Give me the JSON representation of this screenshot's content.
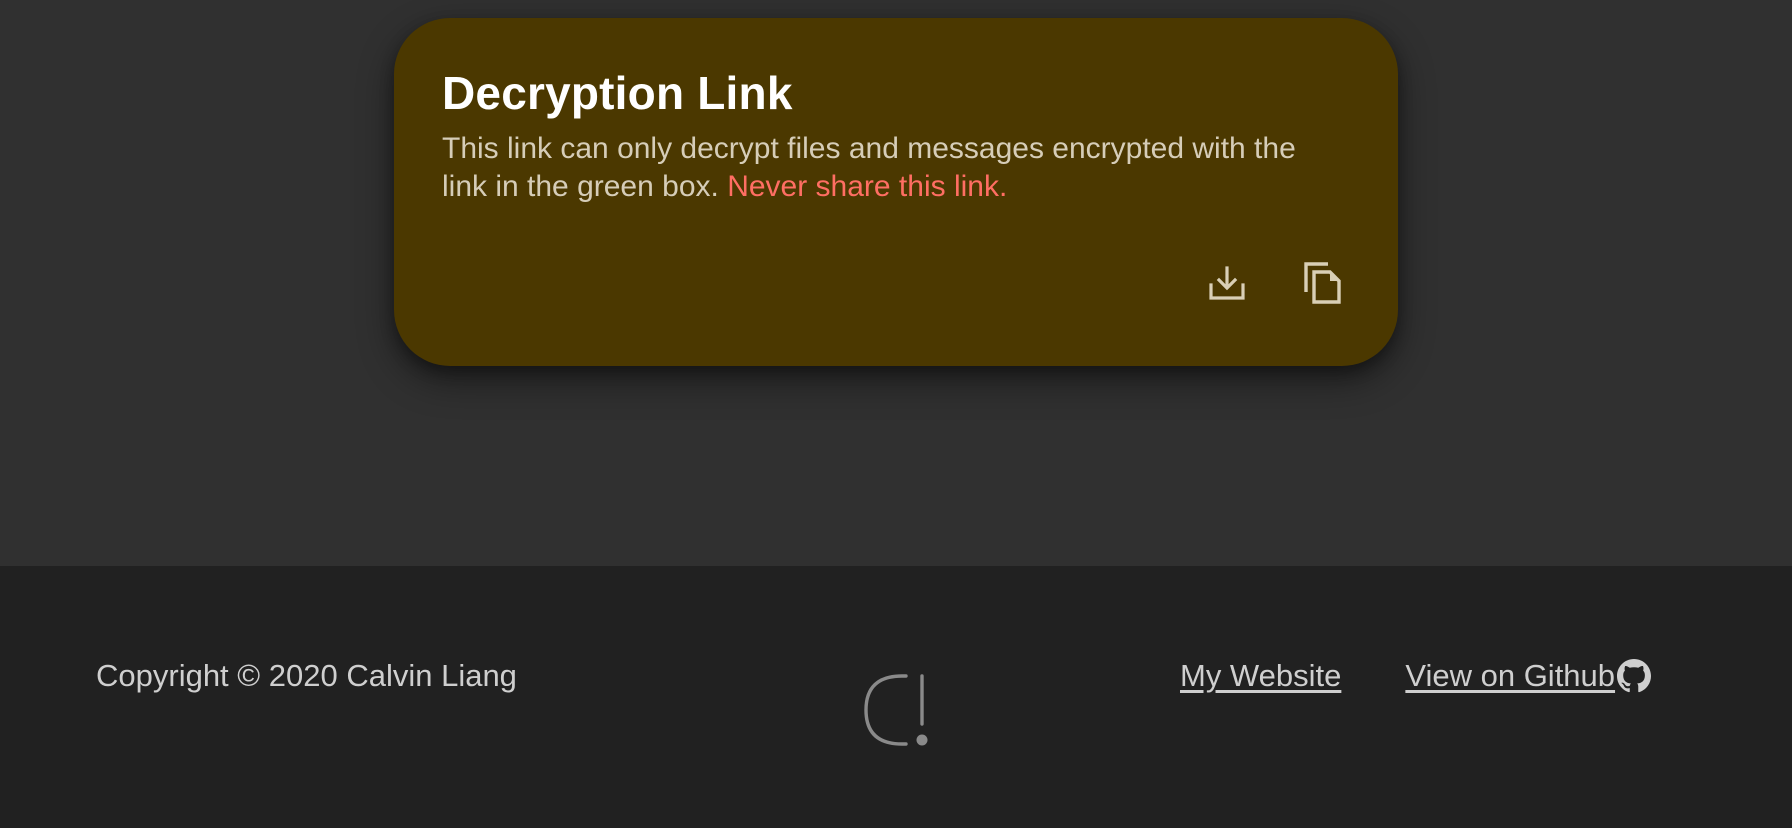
{
  "card": {
    "title": "Decryption Link",
    "description": "This link can only decrypt files and messages encrypted with the link in the green box.",
    "warning": "Never share this link.",
    "actions": [
      {
        "icon": "download-icon",
        "label": "Download"
      },
      {
        "icon": "copy-icon",
        "label": "Copy"
      }
    ],
    "background_color": "#4b3800",
    "warning_color": "#ff6e63"
  },
  "footer": {
    "copyright": "Copyright © 2020 Calvin Liang",
    "logo_icon": "logo-icon",
    "links": {
      "website": "My Website",
      "github": "View on Github"
    },
    "github_icon": "github-icon"
  },
  "colors": {
    "page_background": "#303030",
    "footer_background": "#212121",
    "text": "#cfcfcf"
  }
}
